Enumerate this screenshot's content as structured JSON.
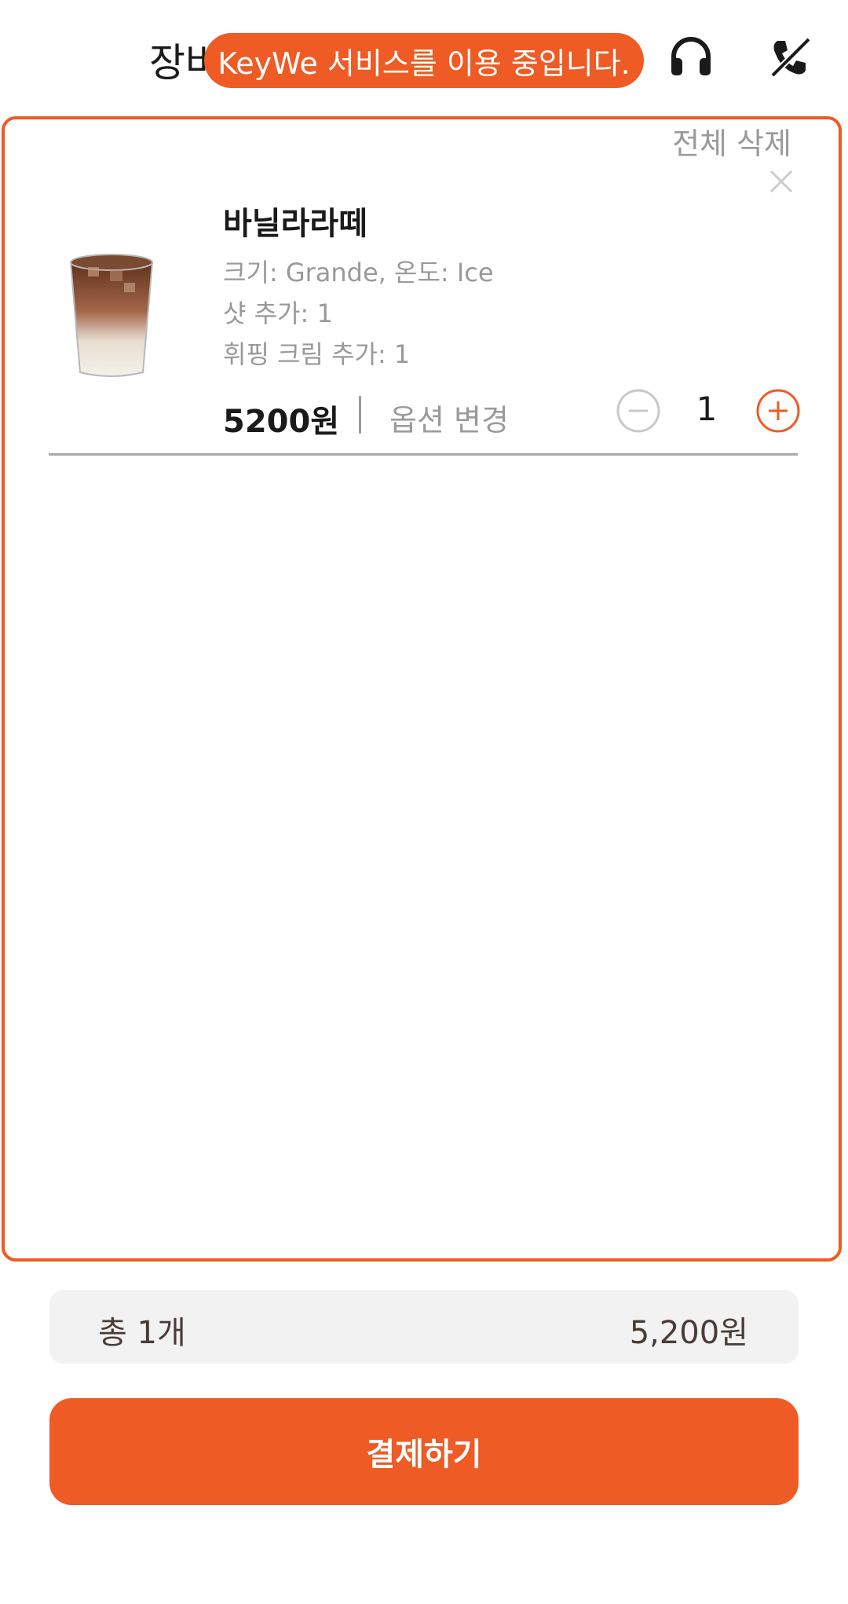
{
  "header": {
    "title": "장바구니",
    "service_banner": "KeyWe 서비스를 이용 중입니다.",
    "icons": [
      "headset-icon",
      "call-off-icon"
    ]
  },
  "cart": {
    "delete_all_label": "전체 삭제",
    "items": [
      {
        "name": "바닐라라떼",
        "options": [
          "크기: Grande, 온도: Ice",
          "샷 추가: 1",
          "휘핑 크림 추가: 1"
        ],
        "price": "5200원",
        "change_option_label": "옵션 변경",
        "quantity": "1"
      }
    ]
  },
  "summary": {
    "count_label": "총 1개",
    "total_amount": "5,200원"
  },
  "checkout": {
    "pay_label": "결제하기"
  },
  "colors": {
    "accent": "#ee5b24",
    "muted_text": "#999999",
    "summary_bg": "#f2f2f2"
  }
}
